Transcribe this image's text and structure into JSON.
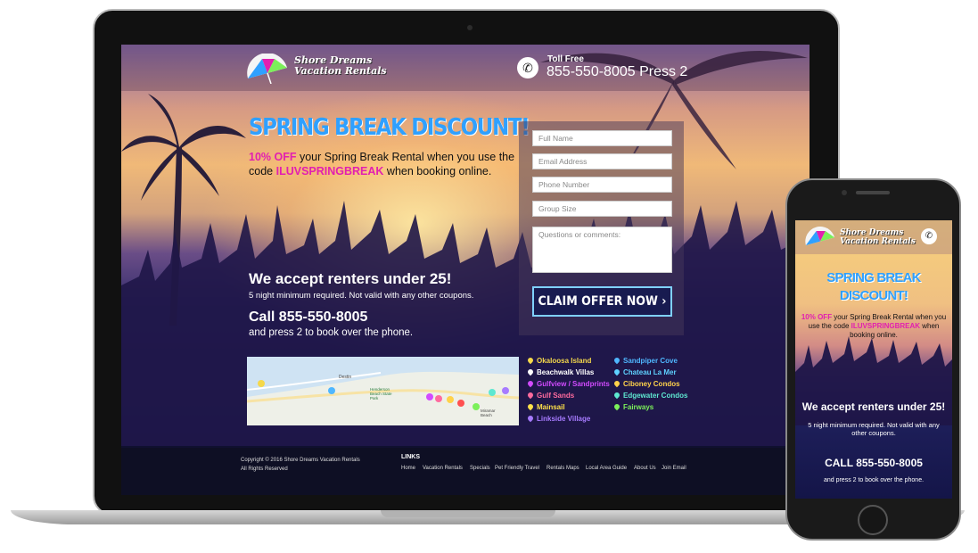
{
  "brand": {
    "name_line1": "Shore Dreams",
    "name_line2": "Vacation Rentals"
  },
  "header": {
    "toll_free_label": "Toll Free",
    "phone_text": "855-550-8005 Press 2"
  },
  "hero": {
    "title": "SPRING BREAK DISCOUNT!",
    "discount": "10% OFF",
    "desc_mid": " your Spring Break Rental when you use the code ",
    "code": "ILUVSPRINGBREAK",
    "desc_end": " when booking online.",
    "accept": "We accept renters under 25!",
    "accept_sub": "5 night minimum required. Not valid with any other coupons.",
    "call": "Call 855-550-8005",
    "call_sub": "and press 2 to book over the phone."
  },
  "form": {
    "full_name_placeholder": "Full Name",
    "email_placeholder": "Email Address",
    "phone_placeholder": "Phone Number",
    "group_placeholder": "Group Size",
    "comments_placeholder": "Questions or comments:",
    "submit_label": "CLAIM OFFER NOW ›"
  },
  "map": {
    "labels": [
      "Destin",
      "Henderson Beach State Park",
      "Miramar Beach"
    ]
  },
  "locations": [
    {
      "name": "Okaloosa Island",
      "color": "#f5d84a"
    },
    {
      "name": "Beachwalk Villas",
      "color": "#ffffff"
    },
    {
      "name": "Gulfview / Sandprints",
      "color": "#d24bff"
    },
    {
      "name": "Gulf Sands",
      "color": "#ff6b9e"
    },
    {
      "name": "Mainsail",
      "color": "#ffe14a"
    },
    {
      "name": "Linkside Village",
      "color": "#a77bff"
    },
    {
      "name": "Sandpiper Cove",
      "color": "#4fb7ff"
    },
    {
      "name": "Chateau La Mer",
      "color": "#5fd2ff"
    },
    {
      "name": "Ciboney Condos",
      "color": "#ffd24a"
    },
    {
      "name": "Edgewater Condos",
      "color": "#5ee8d1"
    },
    {
      "name": "Fairways",
      "color": "#7cf05a"
    }
  ],
  "footer": {
    "copyright": "Copyright © 2016 Shore Dreams Vacation Rentals",
    "rights": "All Rights Reserved",
    "links_title": "LINKS",
    "links": [
      "Home",
      "Vacation Rentals",
      "Specials",
      "Pet Friendly Travel",
      "Rentals Maps",
      "Local Area Guide",
      "About Us",
      "Join Email"
    ]
  },
  "mobile": {
    "title_line1": "SPRING BREAK",
    "title_line2": "DISCOUNT!",
    "discount": "10% OFF",
    "desc_mid": " your Spring Break Rental when you use the code ",
    "code": "ILUVSPRINGBREAK",
    "desc_end": " when booking online.",
    "accept": "We accept renters under 25!",
    "accept_sub": "5 night minimum required. Not valid with any other coupons.",
    "call": "CALL 855-550-8005",
    "call_sub": "and press 2 to book over the phone."
  }
}
